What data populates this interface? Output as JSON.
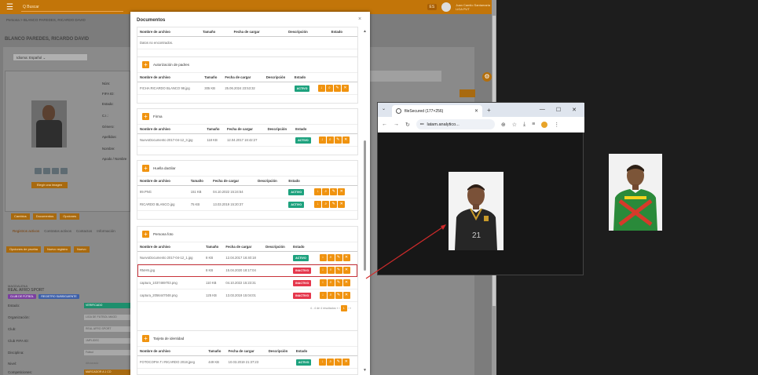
{
  "app": {
    "search_placeholder": "Q Buscar",
    "flag": "ES",
    "user_name": "Juan Camilo Santamaria",
    "user_role": "LiGA FUT",
    "breadcrumb": "Persona > BLANCO PAREDES, RICARDO DAVID",
    "page_title": "BLANCO PAREDES, RICARDO DAVID",
    "language_label": "Idioma:",
    "language_value": "Español",
    "upload_label": "Elegir una imagen",
    "field_labels": [
      "Núm:",
      "FIFA ID:",
      "Estado:",
      "C.I.:",
      "Género:",
      "Apellidos:",
      "Nombre:",
      "Apodo / Nombre"
    ],
    "tabs": [
      "Cambios",
      "Documentos",
      "Opciones"
    ],
    "subtabs": [
      "Registros activos",
      "Contratos activos",
      "Contactos",
      "Información"
    ],
    "actions": [
      "Opciones de prueba",
      "Nuevo registro",
      "Nuevo"
    ],
    "club": {
      "region": "MAGDALENA",
      "name": "REAL AFRO SPORT",
      "tag1": "CLUB DE FÚTBOL",
      "tag2": "REGISTRO SUBSIGUIENTE"
    },
    "kv": [
      {
        "k": "Estado:",
        "v": "VERIFICADO"
      },
      {
        "k": "Organización:",
        "v": "LIGA DE FUTBOL MAGD"
      },
      {
        "k": "Club:",
        "v": "REAL AFRO SPORT"
      },
      {
        "k": "Club FIFA ID:",
        "v": "1MFLIDEC"
      },
      {
        "k": "Disciplina:",
        "v": "Fútbol"
      },
      {
        "k": "Nivel:",
        "v": "Aficionado"
      },
      {
        "k": "Competiciones:",
        "v": "MARCADOR A 1 CO"
      }
    ]
  },
  "modal": {
    "title": "Documentos",
    "close": "×",
    "columns": [
      "Nombre de archivo",
      "Tamaño",
      "Fecha de cargar",
      "Descripción",
      "Estado"
    ],
    "empty_text": "Datos no encontrados.",
    "sections": [
      {
        "title": "Autorización de padres",
        "rows": [
          {
            "name": "FICHA RICARDO BLANCO 98.jpg",
            "size": "305 KB",
            "date": "25.06.2024 23:53:32",
            "status": "ACTIVO"
          }
        ]
      },
      {
        "title": "Firma",
        "rows": [
          {
            "name": "NuevoDocumento 2017-04-12_3.jpg",
            "size": "118 KB",
            "date": "12.04.2017 16:42:27",
            "status": "ACTIVO"
          }
        ]
      },
      {
        "title": "Huella dactilar",
        "rows": [
          {
            "name": "89.PNG",
            "size": "151 KB",
            "date": "04.10.2022 15:24:54",
            "status": "ACTIVO"
          },
          {
            "name": "RICARDO BLANCO.jpg",
            "size": "75 KB",
            "date": "13.03.2019 15:20:37",
            "status": "ACTIVO"
          }
        ]
      },
      {
        "title": "Persona foto",
        "rows": [
          {
            "name": "NuevoDocumento 2017-04-12_1.jpg",
            "size": "8 KB",
            "date": "12.04.2017 16:40:18",
            "status": "ACTIVO"
          },
          {
            "name": "RMAN.jpg",
            "size": "8 KB",
            "date": "15.04.2020 18:17:04",
            "status": "INACTIVO"
          },
          {
            "name": "captura_1037469703.png",
            "size": "110 KB",
            "date": "04.10.2022 15:23:31",
            "status": "INACTIVO"
          },
          {
            "name": "captura_2056447048.png",
            "size": "125 KB",
            "date": "13.03.2019 15:04:01",
            "status": "INACTIVO"
          }
        ],
        "pager": "4 - 4 de 4 resultados"
      },
      {
        "title": "Tarjeta de identidad",
        "rows": [
          {
            "name": "FOTOCOPIA T.I RICARDO 2018.jpeg",
            "size": "449 KB",
            "date": "10.03.2019 21:37:23",
            "status": "ACTIVO"
          }
        ]
      }
    ],
    "page_current": "1"
  },
  "browser": {
    "tab_title": "fileSecured (177×256)",
    "address": "latam.analytico...",
    "jersey_number": "21"
  },
  "colors": {
    "accent": "#f0930f",
    "active": "#1ea27e",
    "inactive": "#e5374c",
    "highlight": "#c8323a"
  }
}
